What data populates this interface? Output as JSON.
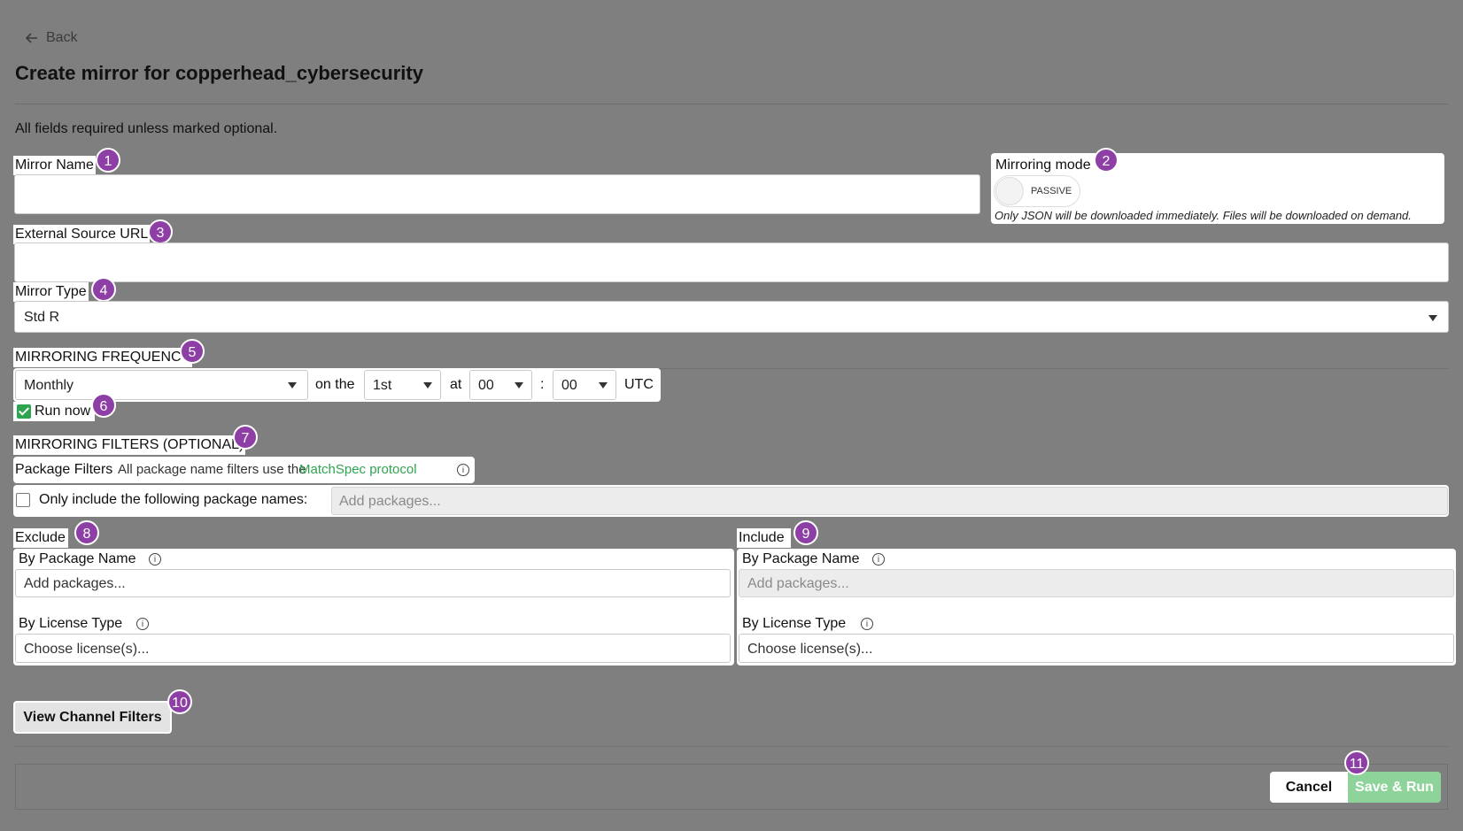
{
  "nav": {
    "back_label": "Back"
  },
  "page": {
    "title": "Create mirror for copperhead_cybersecurity",
    "required_note": "All fields required unless marked optional."
  },
  "mirror_name": {
    "label": "Mirror Name",
    "value": "",
    "badge": "1"
  },
  "mirroring_mode": {
    "label": "Mirroring mode",
    "badge": "2",
    "toggle_label": "PASSIVE",
    "description": "Only JSON will be downloaded immediately. Files will be downloaded on demand."
  },
  "external_source_url": {
    "label": "External Source URL",
    "value": "",
    "badge": "3"
  },
  "mirror_type": {
    "label": "Mirror Type",
    "value": "Std R",
    "badge": "4"
  },
  "frequency": {
    "heading": "MIRRORING FREQUENCY",
    "badge": "5",
    "period": "Monthly",
    "on_the_label": "on the",
    "day": "1st",
    "at_label": "at",
    "hour": "00",
    "separator": ":",
    "minute": "00",
    "tz": "UTC"
  },
  "run_now": {
    "label": "Run now",
    "checked": true,
    "badge": "6"
  },
  "filters": {
    "heading": "MIRRORING FILTERS (OPTIONAL)",
    "badge": "7",
    "package_filters_label": "Package Filters",
    "package_filters_desc": "All package name filters use the",
    "matchspec_link": "MatchSpec protocol",
    "only_include_label": "Only include the following package names:",
    "only_include_placeholder": "Add packages..."
  },
  "exclude": {
    "heading": "Exclude",
    "badge": "8",
    "by_package_label": "By Package Name",
    "package_placeholder": "Add packages...",
    "by_license_label": "By License Type",
    "license_placeholder": "Choose license(s)..."
  },
  "include": {
    "heading": "Include",
    "badge": "9",
    "by_package_label": "By Package Name",
    "package_placeholder": "Add packages...",
    "by_license_label": "By License Type",
    "license_placeholder": "Choose license(s)..."
  },
  "channel_filters": {
    "label": "View Channel Filters",
    "badge": "10"
  },
  "footer": {
    "cancel_label": "Cancel",
    "save_run_label": "Save & Run",
    "badge": "11"
  },
  "colors": {
    "background": "#7f7f7f",
    "badge": "#8e3fa6",
    "accent_green": "#2ea44f"
  }
}
